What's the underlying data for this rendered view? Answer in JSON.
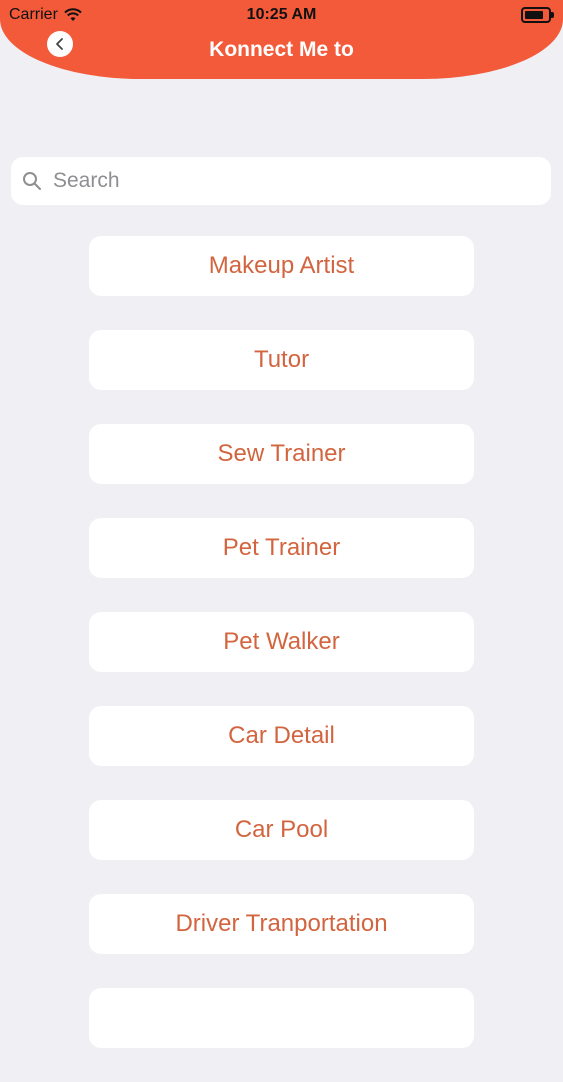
{
  "status_bar": {
    "carrier": "Carrier",
    "time": "10:25 AM"
  },
  "header": {
    "title": "Konnect Me to",
    "back_icon": "chevron-left-icon"
  },
  "search": {
    "placeholder": "Search",
    "icon": "search-icon"
  },
  "list": {
    "items": [
      {
        "label": "Makeup Artist"
      },
      {
        "label": "Tutor"
      },
      {
        "label": "Sew Trainer"
      },
      {
        "label": "Pet Trainer"
      },
      {
        "label": "Pet Walker"
      },
      {
        "label": "Car Detail"
      },
      {
        "label": "Car Pool"
      },
      {
        "label": "Driver Tranportation"
      },
      {
        "label": ""
      }
    ]
  },
  "colors": {
    "accent": "#f25a3a",
    "item_text": "#d2653f",
    "background": "#efeff4"
  }
}
